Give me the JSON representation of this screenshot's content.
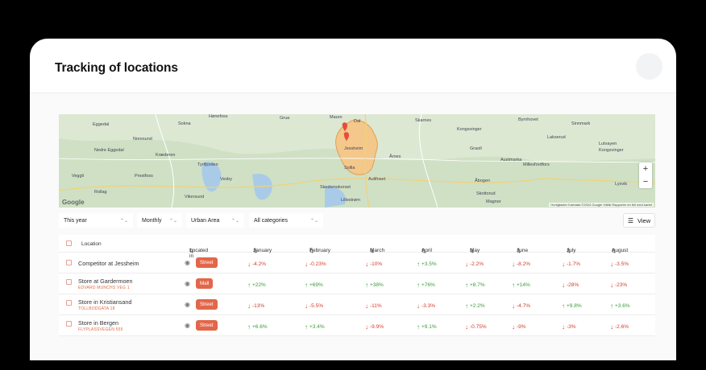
{
  "title": "Tracking of locations",
  "map": {
    "labels": [
      "Eggedal",
      "Sokna",
      "Hønefoss",
      "Grua",
      "Mauro",
      "Dal",
      "Skarnes",
      "Kongsvinger",
      "Byrnhovet",
      "Sinnmark",
      "Noresund",
      "Jessheim",
      "Lakserud",
      "Lutvayen",
      "Nedre Eggedal",
      "Kræderen",
      "Kongsvinger",
      "Grastl",
      "Tyrifjorden",
      "Vesby",
      "Sollla",
      "Årnes",
      "Austmarka",
      "Millesfordfors",
      "Veggli",
      "Prestfoss",
      "Skedsmokorset",
      "Aulifoset",
      "Åbogen",
      "Rollag",
      "Vikersund",
      "Lillestrøm",
      "Skottorud",
      "Lysvik",
      "Magnor"
    ],
    "zoom_in": "+",
    "zoom_out": "−",
    "google": "Google",
    "attribution": "Hurtigtaster   Kartdata ©2024 Google   Vilkår   Rapporter en feil med kartet"
  },
  "filters": {
    "period": "This year",
    "interval": "Monthly",
    "area": "Urban Area",
    "categories": "All categories",
    "view": "View"
  },
  "table": {
    "headers": {
      "location": "Location",
      "located_in": "Located in",
      "months": [
        "January",
        "February",
        "March",
        "April",
        "May",
        "June",
        "July",
        "August"
      ]
    },
    "rows": [
      {
        "name": "Competitor at Jessheim",
        "sub": "",
        "located": "Street",
        "values": [
          [
            "-4.2%",
            "down"
          ],
          [
            "-0.23%",
            "down"
          ],
          [
            "-10%",
            "down"
          ],
          [
            "+3.5%",
            "up"
          ],
          [
            "-2.2%",
            "down"
          ],
          [
            "-8.2%",
            "down"
          ],
          [
            "-1.7%",
            "down"
          ],
          [
            "-3.5%",
            "down"
          ]
        ]
      },
      {
        "name": "Store at Gardermoen",
        "sub": "EDVARD MUNCHS VEG 1",
        "located": "Mall",
        "values": [
          [
            "+22%",
            "up"
          ],
          [
            "+69%",
            "up"
          ],
          [
            "+38%",
            "up"
          ],
          [
            "+76%",
            "up"
          ],
          [
            "+8.7%",
            "up"
          ],
          [
            "+14%",
            "up"
          ],
          [
            "-28%",
            "down"
          ],
          [
            "-23%",
            "down"
          ]
        ]
      },
      {
        "name": "Store in Kristiansand",
        "sub": "TOLLBODGATA 18",
        "located": "Street",
        "values": [
          [
            "-13%",
            "down"
          ],
          [
            "-5.5%",
            "down"
          ],
          [
            "-11%",
            "down"
          ],
          [
            "-3.3%",
            "down"
          ],
          [
            "+2.2%",
            "up"
          ],
          [
            "-4.7%",
            "down"
          ],
          [
            "+9.8%",
            "up"
          ],
          [
            "+3.6%",
            "up"
          ]
        ]
      },
      {
        "name": "Store in Bergen",
        "sub": "FLYPLASSVEGEN 555",
        "located": "Street",
        "values": [
          [
            "+6.6%",
            "up"
          ],
          [
            "+3.4%",
            "up"
          ],
          [
            "-9.9%",
            "down"
          ],
          [
            "+9.1%",
            "up"
          ],
          [
            "-0.75%",
            "down"
          ],
          [
            "-9%",
            "down"
          ],
          [
            "-3%",
            "down"
          ],
          [
            "-2.6%",
            "down"
          ]
        ]
      }
    ]
  },
  "colors": {
    "accent": "#e2674a",
    "up": "#3a9a3a",
    "down": "#d43d2a"
  }
}
